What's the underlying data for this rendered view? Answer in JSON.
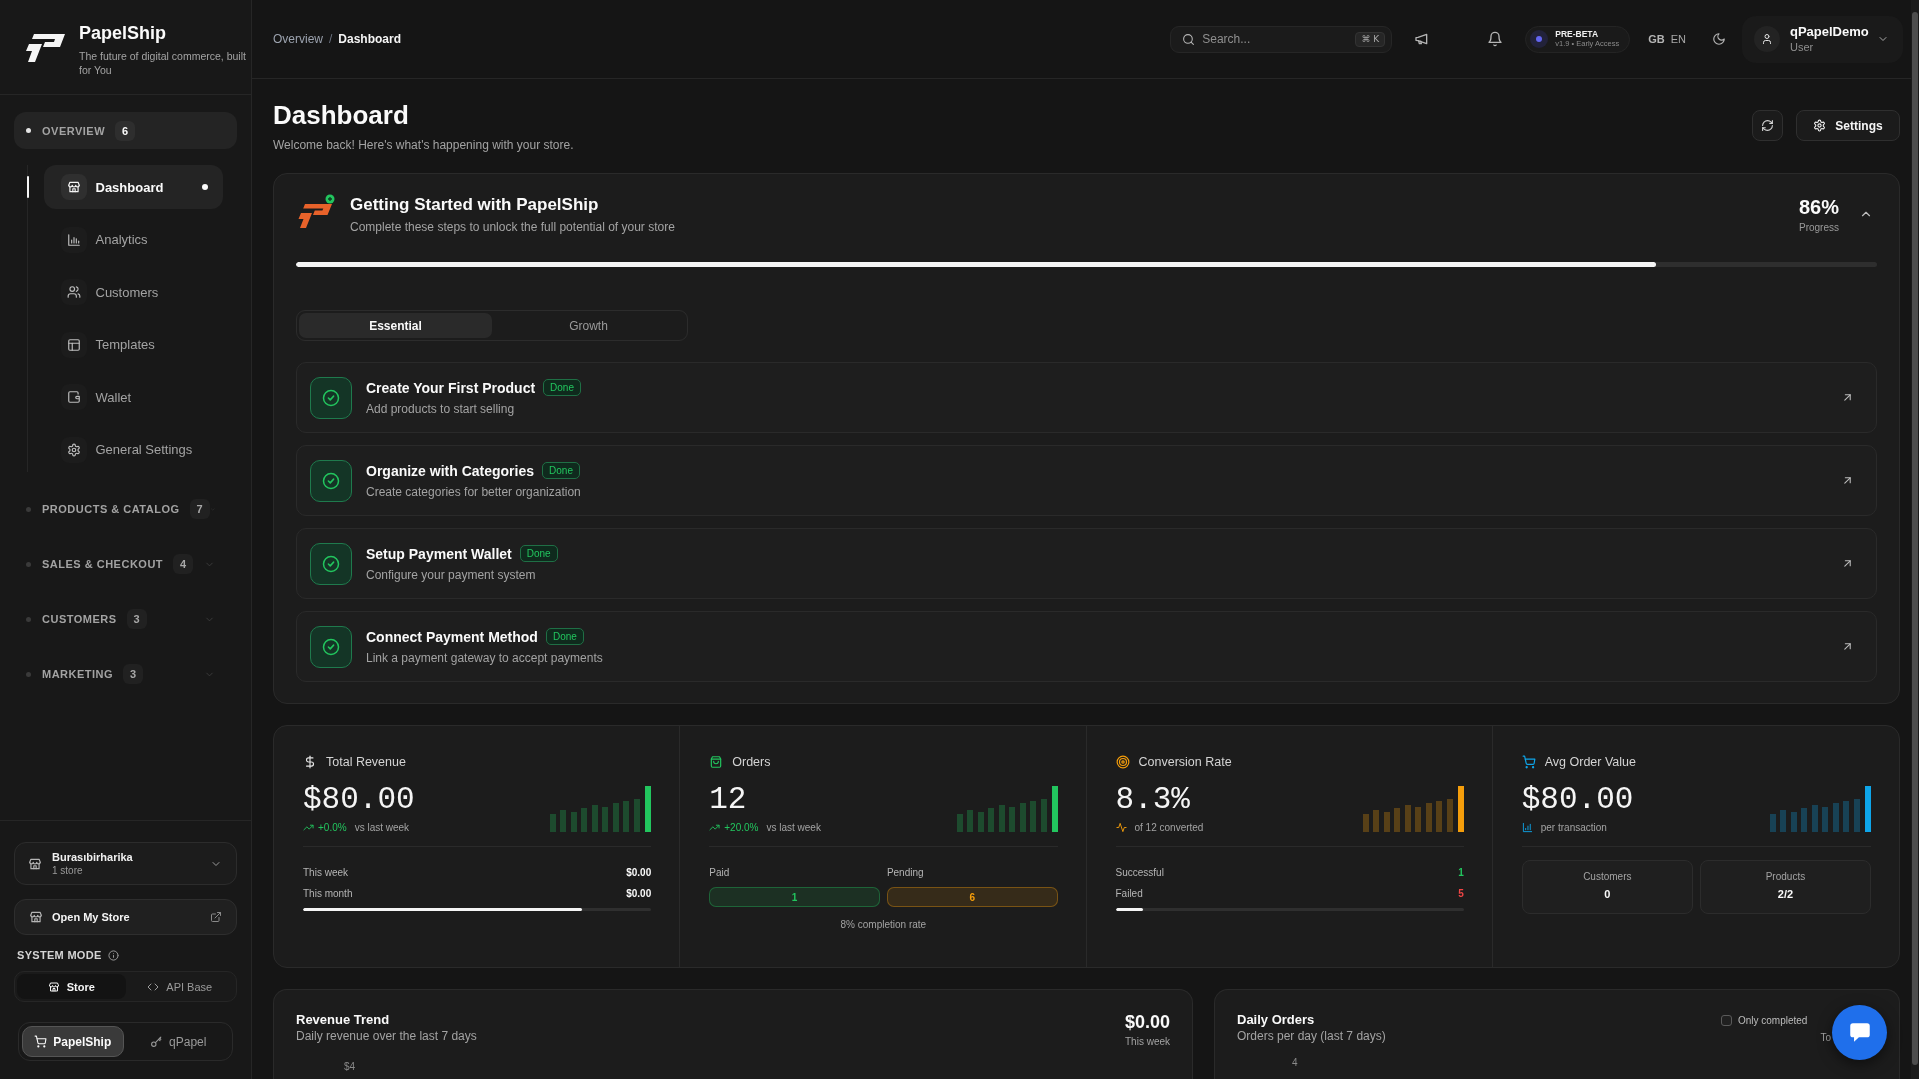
{
  "sidebar": {
    "brand": {
      "name": "PapelShip",
      "tagline": "The future of digital commerce, built for You"
    },
    "groups": [
      {
        "label": "OVERVIEW",
        "count": "6",
        "expanded": true,
        "items": [
          {
            "label": "Dashboard",
            "selected": true
          },
          {
            "label": "Analytics",
            "selected": false
          },
          {
            "label": "Customers",
            "selected": false
          },
          {
            "label": "Templates",
            "selected": false
          },
          {
            "label": "Wallet",
            "selected": false
          },
          {
            "label": "General Settings",
            "selected": false
          }
        ]
      },
      {
        "label": "PRODUCTS & CATALOG",
        "count": "7",
        "expanded": false
      },
      {
        "label": "SALES & CHECKOUT",
        "count": "4",
        "expanded": false
      },
      {
        "label": "CUSTOMERS",
        "count": "3",
        "expanded": false
      },
      {
        "label": "MARKETING",
        "count": "3",
        "expanded": false
      }
    ],
    "store": {
      "name": "Burasıbirharika",
      "detail": "1 store"
    },
    "open_store": "Open My Store",
    "system_mode": {
      "label": "SYSTEM MODE",
      "options": [
        {
          "label": "Store",
          "selected": true
        },
        {
          "label": "API Base",
          "selected": false
        }
      ]
    },
    "apps": [
      {
        "label": "PapelShip",
        "selected": true
      },
      {
        "label": "qPapel",
        "selected": false
      }
    ]
  },
  "header": {
    "breadcrumb": {
      "items": [
        "Overview",
        "Dashboard"
      ],
      "separator": "/"
    },
    "search": {
      "placeholder": "Search...",
      "shortcut": "⌘ K"
    },
    "release": {
      "label": "PRE-BETA",
      "detail": "v1.9 • Early Access"
    },
    "language": {
      "region": "GB",
      "code": "EN"
    },
    "user": {
      "name": "qPapelDemo",
      "role": "User"
    }
  },
  "page": {
    "title": "Dashboard",
    "subtitle": "Welcome back! Here's what's happening with your store.",
    "settings_button": "Settings"
  },
  "getting_started": {
    "title": "Getting Started with PapelShip",
    "subtitle": "Complete these steps to unlock the full potential of your store",
    "progress": "86%",
    "progress_label": "Progress",
    "level": 0.86,
    "expanded": true,
    "tabs": [
      {
        "label": "Essential",
        "selected": true
      },
      {
        "label": "Growth",
        "selected": false
      }
    ],
    "tasks": [
      {
        "title": "Create Your First Product",
        "description": "Add products to start selling",
        "done": true,
        "badge": "Done"
      },
      {
        "title": "Organize with Categories",
        "description": "Create categories for better organization",
        "done": true,
        "badge": "Done"
      },
      {
        "title": "Setup Payment Wallet",
        "description": "Configure your payment system",
        "done": true,
        "badge": "Done"
      },
      {
        "title": "Connect Payment Method",
        "description": "Link a payment gateway to accept payments",
        "done": true,
        "badge": "Done"
      }
    ]
  },
  "stats": [
    {
      "kind": "revenue",
      "title": "Total Revenue",
      "value": "$80.00",
      "color": "#22c55e",
      "change": "+0.0%",
      "note": "vs last week",
      "rows": [
        {
          "label": "This week",
          "value": "$0.00"
        },
        {
          "label": "This month",
          "value": "$0.00"
        }
      ],
      "level": 0.8
    },
    {
      "kind": "orders",
      "title": "Orders",
      "value": "12",
      "color": "#22c55e",
      "change": "+20.0%",
      "note": "vs last week",
      "pills": [
        {
          "label": "Paid",
          "value": "1",
          "color": "#22c55e"
        },
        {
          "label": "Pending",
          "value": "6",
          "color": "#f59e0b"
        }
      ],
      "footnote": "8% completion rate"
    },
    {
      "kind": "conversion",
      "title": "Conversion Rate",
      "value": "8.3%",
      "color": "#f59e0b",
      "note": "of 12 converted",
      "rows": [
        {
          "label": "Successful",
          "value": "1",
          "color": "#22c55e"
        },
        {
          "label": "Failed",
          "value": "5",
          "color": "#ef4444"
        }
      ],
      "level": 0.08
    },
    {
      "kind": "average",
      "title": "Avg Order Value",
      "value": "$80.00",
      "color": "#0ea5e9",
      "note": "per transaction",
      "tiles": [
        {
          "label": "Customers",
          "value": "0"
        },
        {
          "label": "Products",
          "value": "2/2"
        }
      ]
    }
  ],
  "charts": [
    {
      "title": "Revenue Trend",
      "subtitle": "Daily revenue over the last 7 days",
      "total": "$0.00",
      "total_label": "This week",
      "axis_tick": "$4"
    },
    {
      "title": "Daily Orders",
      "subtitle": "Orders per day (last 7 days)",
      "filter": {
        "label": "Only completed",
        "checked": false
      },
      "partial_text": "To",
      "axis_tick": "4"
    }
  ]
}
